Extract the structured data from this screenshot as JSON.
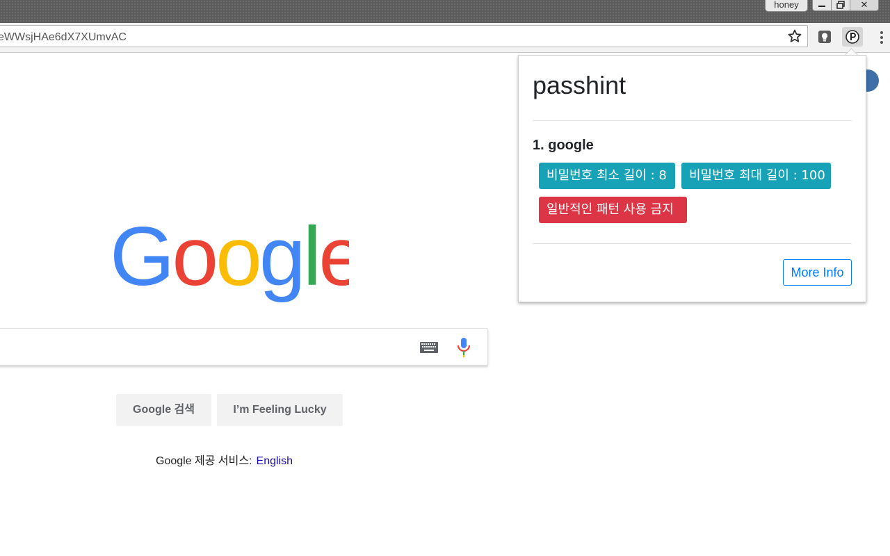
{
  "window": {
    "profile_name": "honey",
    "controls": {
      "minimize": "minimize-icon",
      "restore": "restore-icon",
      "close": "✕"
    }
  },
  "toolbar": {
    "url": "eWWsjHAe6dX7XUmvAC",
    "icons": [
      "star-icon",
      "lightbulb-extension-icon",
      "passhint-extension-icon",
      "menu-icon"
    ]
  },
  "google": {
    "logo": "Google",
    "search_button": "Google 검색",
    "lucky_button": "I’m Feeling Lucky",
    "lang_prefix": "Google 제공 서비스:",
    "lang_link": "English"
  },
  "popup": {
    "title": "passhint",
    "site": "1. google",
    "badges": [
      {
        "text": "비밀번호 최소 길이 : 8",
        "color": "#17a2b8"
      },
      {
        "text": "비밀번호 최대 길이 : 100",
        "color": "#17a2b8"
      },
      {
        "text": "일반적인 패턴 사용 금지",
        "color": "#dc3545"
      }
    ],
    "more_info": "More Info"
  }
}
